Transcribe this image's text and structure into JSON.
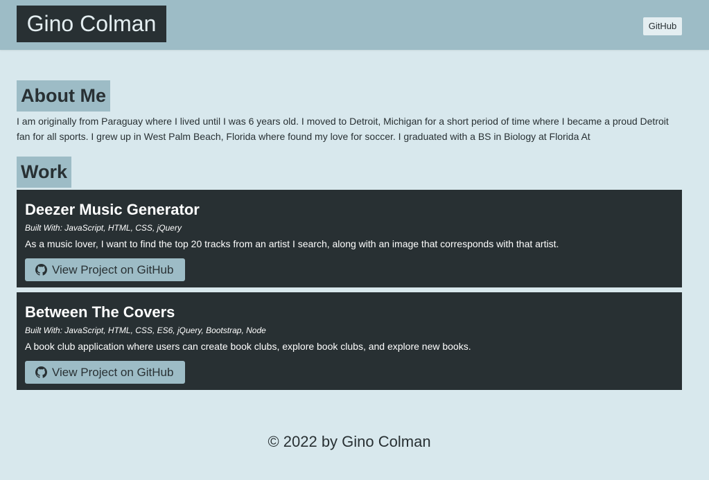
{
  "header": {
    "site_title": "Gino Colman",
    "github_label": "GitHub"
  },
  "about": {
    "heading": "About Me",
    "text": "I am originally from Paraguay where I lived until I was 6 years old. I moved to Detroit, Michigan for a short period of time where I became a proud Detroit fan for all sports. I grew up in West Palm Beach, Florida where found my love for soccer. I graduated with a BS in Biology at Florida At"
  },
  "work": {
    "heading": "Work",
    "projects": [
      {
        "title": "Deezer Music Generator",
        "tech": "Built With: JavaScript, HTML, CSS, jQuery",
        "description": "As a music lover, I want to find the top 20 tracks from an artist I search, along with an image that corresponds with that artist.",
        "button_label": "View Project on GitHub",
        "icon": "github-icon"
      },
      {
        "title": "Between The Covers",
        "tech": "Built With: JavaScript, HTML, CSS, ES6, jQuery, Bootstrap, Node",
        "description": "A book club application where users can create book clubs, explore book clubs, and explore new books.",
        "button_label": "View Project on GitHub",
        "icon": "github-icon"
      }
    ]
  },
  "footer": {
    "text": "© 2022 by Gino Colman"
  },
  "colors": {
    "page_background": "#d8e8ed",
    "accent": "#9dbcc6",
    "dark": "#283033"
  }
}
